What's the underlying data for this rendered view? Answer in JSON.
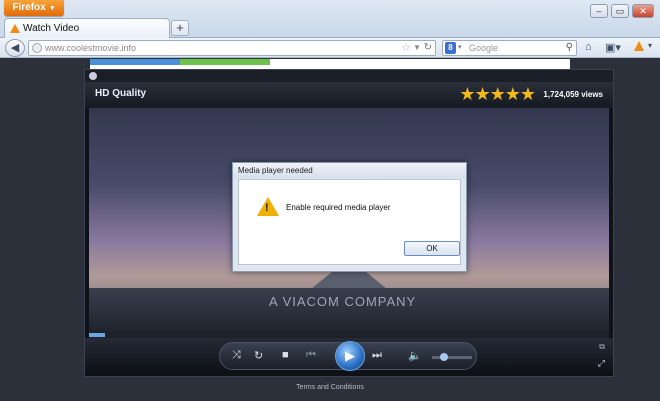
{
  "browser": {
    "menu_button": "Firefox",
    "tab_title": "Watch Video",
    "new_tab": "+",
    "url": "www.coolestmovie.info",
    "search_placeholder": "Google",
    "search_engine_letter": "8",
    "window_controls": [
      "minimize",
      "maximize",
      "close"
    ]
  },
  "player": {
    "quality_label": "HD Quality",
    "stars": "★★★★★",
    "rating": 5,
    "views": "1,724,059 views",
    "video_watermark": "A VIACOM COMPANY",
    "progress": 0.03,
    "volume": 0.3
  },
  "dialog": {
    "title": "Media player needed",
    "message": "Enable required media player",
    "ok_button": "OK"
  },
  "footer": {
    "terms": "Terms and Conditions"
  },
  "colors": {
    "firefox_orange": "#e26b0a",
    "star_gold": "#f2b91a",
    "play_blue": "#2a6fc4",
    "warning_yellow": "#f0b000"
  }
}
